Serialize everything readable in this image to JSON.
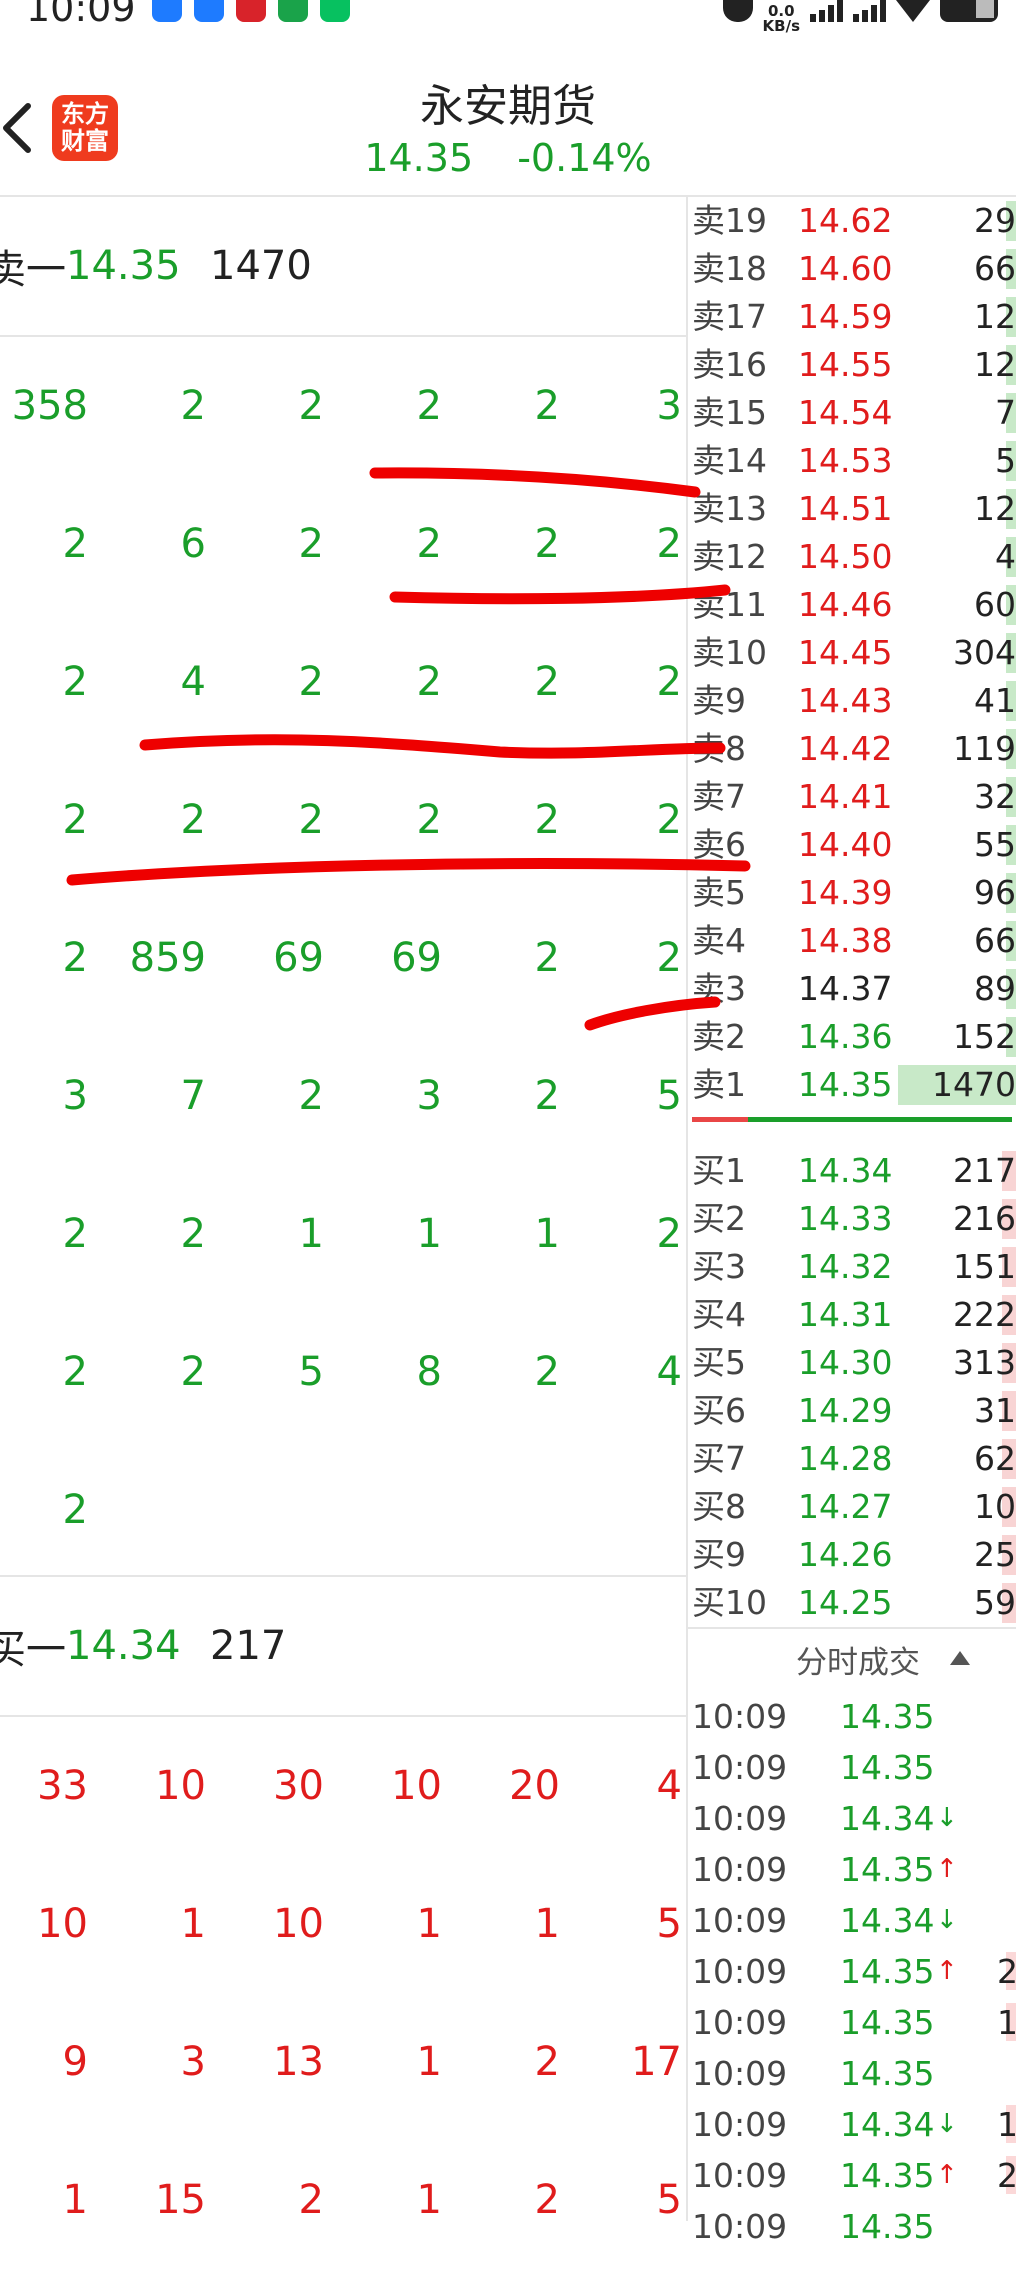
{
  "status": {
    "time": "10:09",
    "net_speed_top": "0.0",
    "net_speed_unit": "KB/s",
    "app_colors": [
      "#1e7bff",
      "#1e7bff",
      "#d8232a",
      "#1aa34a",
      "#07c160"
    ]
  },
  "header": {
    "logo_line1": "东方",
    "logo_line2": "财富",
    "title": "永安期货",
    "price": "14.35",
    "change": "-0.14%"
  },
  "queue": {
    "ask_label": "卖一",
    "ask_price": "14.35",
    "ask_volume": "1470",
    "ask_rows": [
      [
        "358",
        "2",
        "2",
        "2",
        "2",
        "3"
      ],
      [
        "2",
        "6",
        "2",
        "2",
        "2",
        "2"
      ],
      [
        "2",
        "4",
        "2",
        "2",
        "2",
        "2"
      ],
      [
        "2",
        "2",
        "2",
        "2",
        "2",
        "2"
      ],
      [
        "2",
        "859",
        "69",
        "69",
        "2",
        "2"
      ],
      [
        "3",
        "7",
        "2",
        "3",
        "2",
        "5"
      ],
      [
        "2",
        "2",
        "1",
        "1",
        "1",
        "2"
      ],
      [
        "2",
        "2",
        "5",
        "8",
        "2",
        "4"
      ],
      [
        "2"
      ]
    ],
    "bid_label": "买一",
    "bid_price": "14.34",
    "bid_volume": "217",
    "bid_rows": [
      [
        "33",
        "10",
        "30",
        "10",
        "20",
        "4"
      ],
      [
        "10",
        "1",
        "10",
        "1",
        "1",
        "5"
      ],
      [
        "9",
        "3",
        "13",
        "1",
        "2",
        "17"
      ],
      [
        "1",
        "15",
        "2",
        "1",
        "2",
        "5"
      ]
    ]
  },
  "orderbook": {
    "asks": [
      {
        "name": "卖19",
        "price": "14.62",
        "vol": "29",
        "color": "#e01c1c"
      },
      {
        "name": "卖18",
        "price": "14.60",
        "vol": "66",
        "color": "#e01c1c"
      },
      {
        "name": "卖17",
        "price": "14.59",
        "vol": "12",
        "color": "#e01c1c"
      },
      {
        "name": "卖16",
        "price": "14.55",
        "vol": "12",
        "color": "#e01c1c"
      },
      {
        "name": "卖15",
        "price": "14.54",
        "vol": "7",
        "color": "#e01c1c"
      },
      {
        "name": "卖14",
        "price": "14.53",
        "vol": "5",
        "color": "#e01c1c"
      },
      {
        "name": "卖13",
        "price": "14.51",
        "vol": "12",
        "color": "#e01c1c"
      },
      {
        "name": "卖12",
        "price": "14.50",
        "vol": "4",
        "color": "#e01c1c"
      },
      {
        "name": "卖11",
        "price": "14.46",
        "vol": "60",
        "color": "#e01c1c"
      },
      {
        "name": "卖10",
        "price": "14.45",
        "vol": "304",
        "color": "#e01c1c"
      },
      {
        "name": "卖9",
        "price": "14.43",
        "vol": "41",
        "color": "#e01c1c"
      },
      {
        "name": "卖8",
        "price": "14.42",
        "vol": "119",
        "color": "#e01c1c"
      },
      {
        "name": "卖7",
        "price": "14.41",
        "vol": "32",
        "color": "#e01c1c"
      },
      {
        "name": "卖6",
        "price": "14.40",
        "vol": "55",
        "color": "#e01c1c"
      },
      {
        "name": "卖5",
        "price": "14.39",
        "vol": "96",
        "color": "#e01c1c"
      },
      {
        "name": "卖4",
        "price": "14.38",
        "vol": "66",
        "color": "#e01c1c"
      },
      {
        "name": "卖3",
        "price": "14.37",
        "vol": "89",
        "color": "#222222"
      },
      {
        "name": "卖2",
        "price": "14.36",
        "vol": "152",
        "color": "#1a9e2a"
      },
      {
        "name": "卖1",
        "price": "14.35",
        "vol": "1470",
        "color": "#1a9e2a"
      }
    ],
    "bids": [
      {
        "name": "买1",
        "price": "14.34",
        "vol": "217"
      },
      {
        "name": "买2",
        "price": "14.33",
        "vol": "216"
      },
      {
        "name": "买3",
        "price": "14.32",
        "vol": "151"
      },
      {
        "name": "买4",
        "price": "14.31",
        "vol": "222"
      },
      {
        "name": "买5",
        "price": "14.30",
        "vol": "313"
      },
      {
        "name": "买6",
        "price": "14.29",
        "vol": "31"
      },
      {
        "name": "买7",
        "price": "14.28",
        "vol": "62"
      },
      {
        "name": "买8",
        "price": "14.27",
        "vol": "10"
      },
      {
        "name": "买9",
        "price": "14.26",
        "vol": "25"
      },
      {
        "name": "买10",
        "price": "14.25",
        "vol": "59"
      }
    ]
  },
  "ticks": {
    "title": "分时成交",
    "rows": [
      {
        "time": "10:09",
        "price": "14.35",
        "dir": "",
        "vol": ""
      },
      {
        "time": "10:09",
        "price": "14.35",
        "dir": "",
        "vol": ""
      },
      {
        "time": "10:09",
        "price": "14.34",
        "dir": "↓",
        "vol": ""
      },
      {
        "time": "10:09",
        "price": "14.35",
        "dir": "↑",
        "vol": ""
      },
      {
        "time": "10:09",
        "price": "14.34",
        "dir": "↓",
        "vol": ""
      },
      {
        "time": "10:09",
        "price": "14.35",
        "dir": "↑",
        "vol": "2"
      },
      {
        "time": "10:09",
        "price": "14.35",
        "dir": "",
        "vol": "1"
      },
      {
        "time": "10:09",
        "price": "14.35",
        "dir": "",
        "vol": ""
      },
      {
        "time": "10:09",
        "price": "14.34",
        "dir": "↓",
        "vol": "1"
      },
      {
        "time": "10:09",
        "price": "14.35",
        "dir": "↑",
        "vol": "2"
      },
      {
        "time": "10:09",
        "price": "14.35",
        "dir": "",
        "vol": ""
      }
    ]
  }
}
